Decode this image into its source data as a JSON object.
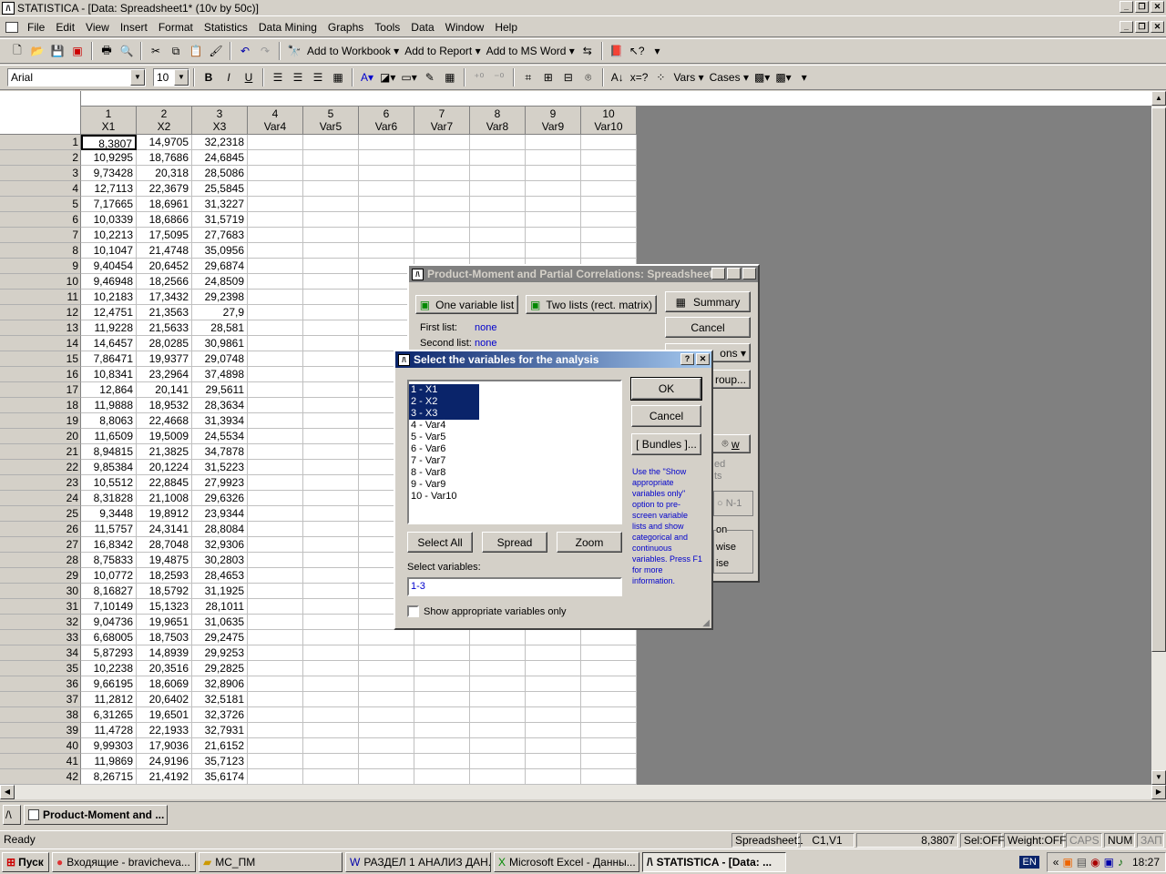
{
  "window": {
    "title": "STATISTICA - [Data: Spreadsheet1* (10v by 50c)]"
  },
  "menu": [
    "File",
    "Edit",
    "View",
    "Insert",
    "Format",
    "Statistics",
    "Data Mining",
    "Graphs",
    "Tools",
    "Data",
    "Window",
    "Help"
  ],
  "toolbar1": {
    "add_to_workbook": "Add to Workbook",
    "add_to_report": "Add to Report",
    "add_to_msword": "Add to MS Word"
  },
  "toolbar2": {
    "font": "Arial",
    "size": "10",
    "vars": "Vars",
    "cases": "Cases"
  },
  "columns": [
    {
      "num": "1",
      "name": "X1"
    },
    {
      "num": "2",
      "name": "X2"
    },
    {
      "num": "3",
      "name": "X3"
    },
    {
      "num": "4",
      "name": "Var4"
    },
    {
      "num": "5",
      "name": "Var5"
    },
    {
      "num": "6",
      "name": "Var6"
    },
    {
      "num": "7",
      "name": "Var7"
    },
    {
      "num": "8",
      "name": "Var8"
    },
    {
      "num": "9",
      "name": "Var9"
    },
    {
      "num": "10",
      "name": "Var10"
    }
  ],
  "rows": [
    [
      "8,3807",
      "14,9705",
      "32,2318"
    ],
    [
      "10,9295",
      "18,7686",
      "24,6845"
    ],
    [
      "9,73428",
      "20,318",
      "28,5086"
    ],
    [
      "12,7113",
      "22,3679",
      "25,5845"
    ],
    [
      "7,17665",
      "18,6961",
      "31,3227"
    ],
    [
      "10,0339",
      "18,6866",
      "31,5719"
    ],
    [
      "10,2213",
      "17,5095",
      "27,7683"
    ],
    [
      "10,1047",
      "21,4748",
      "35,0956"
    ],
    [
      "9,40454",
      "20,6452",
      "29,6874"
    ],
    [
      "9,46948",
      "18,2566",
      "24,8509"
    ],
    [
      "10,2183",
      "17,3432",
      "29,2398"
    ],
    [
      "12,4751",
      "21,3563",
      "27,9"
    ],
    [
      "11,9228",
      "21,5633",
      "28,581"
    ],
    [
      "14,6457",
      "28,0285",
      "30,9861"
    ],
    [
      "7,86471",
      "19,9377",
      "29,0748"
    ],
    [
      "10,8341",
      "23,2964",
      "37,4898"
    ],
    [
      "12,864",
      "20,141",
      "29,5611"
    ],
    [
      "11,9888",
      "18,9532",
      "28,3634"
    ],
    [
      "8,8063",
      "22,4668",
      "31,3934"
    ],
    [
      "11,6509",
      "19,5009",
      "24,5534"
    ],
    [
      "8,94815",
      "21,3825",
      "34,7878"
    ],
    [
      "9,85384",
      "20,1224",
      "31,5223"
    ],
    [
      "10,5512",
      "22,8845",
      "27,9923"
    ],
    [
      "8,31828",
      "21,1008",
      "29,6326"
    ],
    [
      "9,3448",
      "19,8912",
      "23,9344"
    ],
    [
      "11,5757",
      "24,3141",
      "28,8084"
    ],
    [
      "16,8342",
      "28,7048",
      "32,9306"
    ],
    [
      "8,75833",
      "19,4875",
      "30,2803"
    ],
    [
      "10,0772",
      "18,2593",
      "28,4653"
    ],
    [
      "8,16827",
      "18,5792",
      "31,1925"
    ],
    [
      "7,10149",
      "15,1323",
      "28,1011"
    ],
    [
      "9,04736",
      "19,9651",
      "31,0635"
    ],
    [
      "6,68005",
      "18,7503",
      "29,2475"
    ],
    [
      "5,87293",
      "14,8939",
      "29,9253"
    ],
    [
      "10,2238",
      "20,3516",
      "29,2825"
    ],
    [
      "9,66195",
      "18,6069",
      "32,8906"
    ],
    [
      "11,2812",
      "20,6402",
      "32,5181"
    ],
    [
      "6,31265",
      "19,6501",
      "32,3726"
    ],
    [
      "11,4728",
      "22,1933",
      "32,7931"
    ],
    [
      "9,99303",
      "17,9036",
      "21,6152"
    ],
    [
      "11,9869",
      "24,9196",
      "35,7123"
    ],
    [
      "8,26715",
      "21,4192",
      "35,6174"
    ]
  ],
  "corr_dialog": {
    "title": "Product-Moment and Partial Correlations: Spreadsheet",
    "one_list": "One variable list",
    "two_lists": "Two lists (rect. matrix)",
    "summary": "Summary",
    "cancel": "Cancel",
    "first_list_label": "First list:",
    "first_list_value": "none",
    "second_list_label": "Second list:",
    "second_list_value": "none",
    "options_frag": "ons",
    "group_frag": "roup...",
    "w_frag": "w",
    "ed_frag": "ed",
    "ts_frag": "ts",
    "n1_frag": "N-1",
    "on_frag": "on",
    "wise_frag": "wise",
    "ise_frag": "ise"
  },
  "select_dialog": {
    "title": "Select the variables for the analysis",
    "items": [
      "1 - X1",
      "2 - X2",
      "3 - X3",
      "4 - Var4",
      "5 - Var5",
      "6 - Var6",
      "7 - Var7",
      "8 - Var8",
      "9 - Var9",
      "10 - Var10"
    ],
    "ok": "OK",
    "cancel": "Cancel",
    "bundles": "[ Bundles ]...",
    "hint": "Use the \"Show appropriate variables only\" option to pre-screen variable lists and show categorical and continuous variables. Press F1 for more information.",
    "select_all": "Select All",
    "spread": "Spread",
    "zoom": "Zoom",
    "select_label": "Select variables:",
    "select_value": "1-3",
    "show_appropriate": "Show appropriate variables only"
  },
  "mdi_task": "Product-Moment and ...",
  "status": {
    "ready": "Ready",
    "sheet": "Spreadsheet1",
    "cell": "C1,V1",
    "value": "8,3807",
    "sel": "Sel:OFF",
    "weight": "Weight:OFF",
    "caps": "CAPS",
    "num": "NUM",
    "zap": "ЗАП"
  },
  "taskbar": {
    "start": "Пуск",
    "items": [
      "Входящие - bravicheva...",
      "МС_ПМ",
      "РАЗДЕЛ 1 АНАЛИЗ ДАН...",
      "Microsoft Excel - Данны...",
      "STATISTICA - [Data: ..."
    ],
    "lang": "EN",
    "time": "18:27"
  }
}
